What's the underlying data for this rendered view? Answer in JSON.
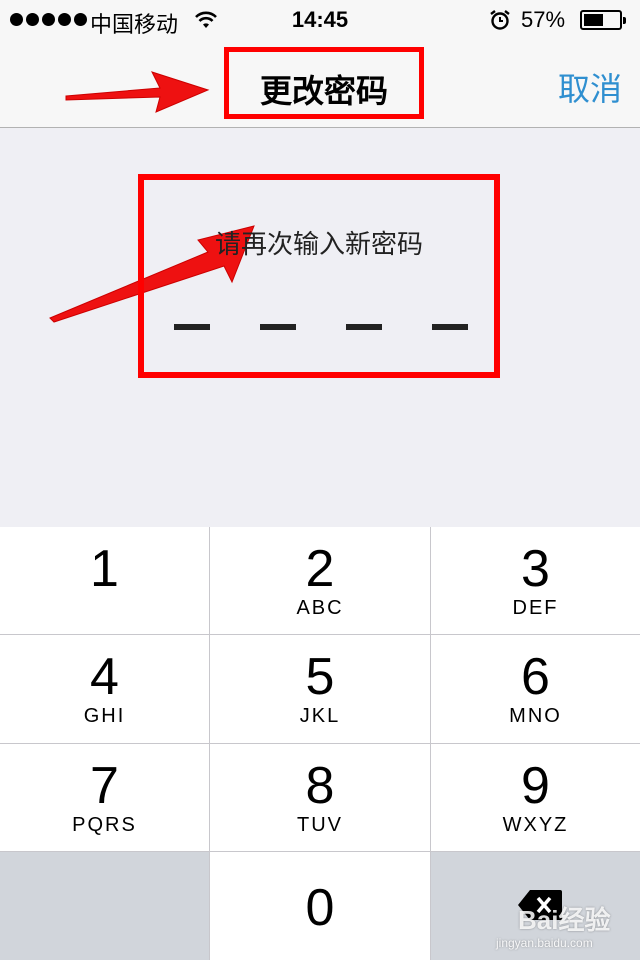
{
  "status_bar": {
    "carrier": "中国移动",
    "time": "14:45",
    "battery_percent_text": "57%",
    "battery_level": 0.57
  },
  "nav": {
    "title": "更改密码",
    "cancel_label": "取消"
  },
  "prompt": {
    "text": "请再次输入新密码",
    "digits_entered": 0,
    "digits_total": 4
  },
  "keypad": {
    "keys": [
      {
        "digit": "1",
        "letters": ""
      },
      {
        "digit": "2",
        "letters": "ABC"
      },
      {
        "digit": "3",
        "letters": "DEF"
      },
      {
        "digit": "4",
        "letters": "GHI"
      },
      {
        "digit": "5",
        "letters": "JKL"
      },
      {
        "digit": "6",
        "letters": "MNO"
      },
      {
        "digit": "7",
        "letters": "PQRS"
      },
      {
        "digit": "8",
        "letters": "TUV"
      },
      {
        "digit": "9",
        "letters": "WXYZ"
      },
      {
        "digit": "0",
        "letters": ""
      }
    ]
  },
  "watermark": {
    "text": "Bai经验",
    "url": "jingyan.baidu.com"
  },
  "colors": {
    "annotation_red": "#ff0000",
    "link_blue": "#2f8fd0",
    "keypad_gray": "#d1d5db"
  }
}
